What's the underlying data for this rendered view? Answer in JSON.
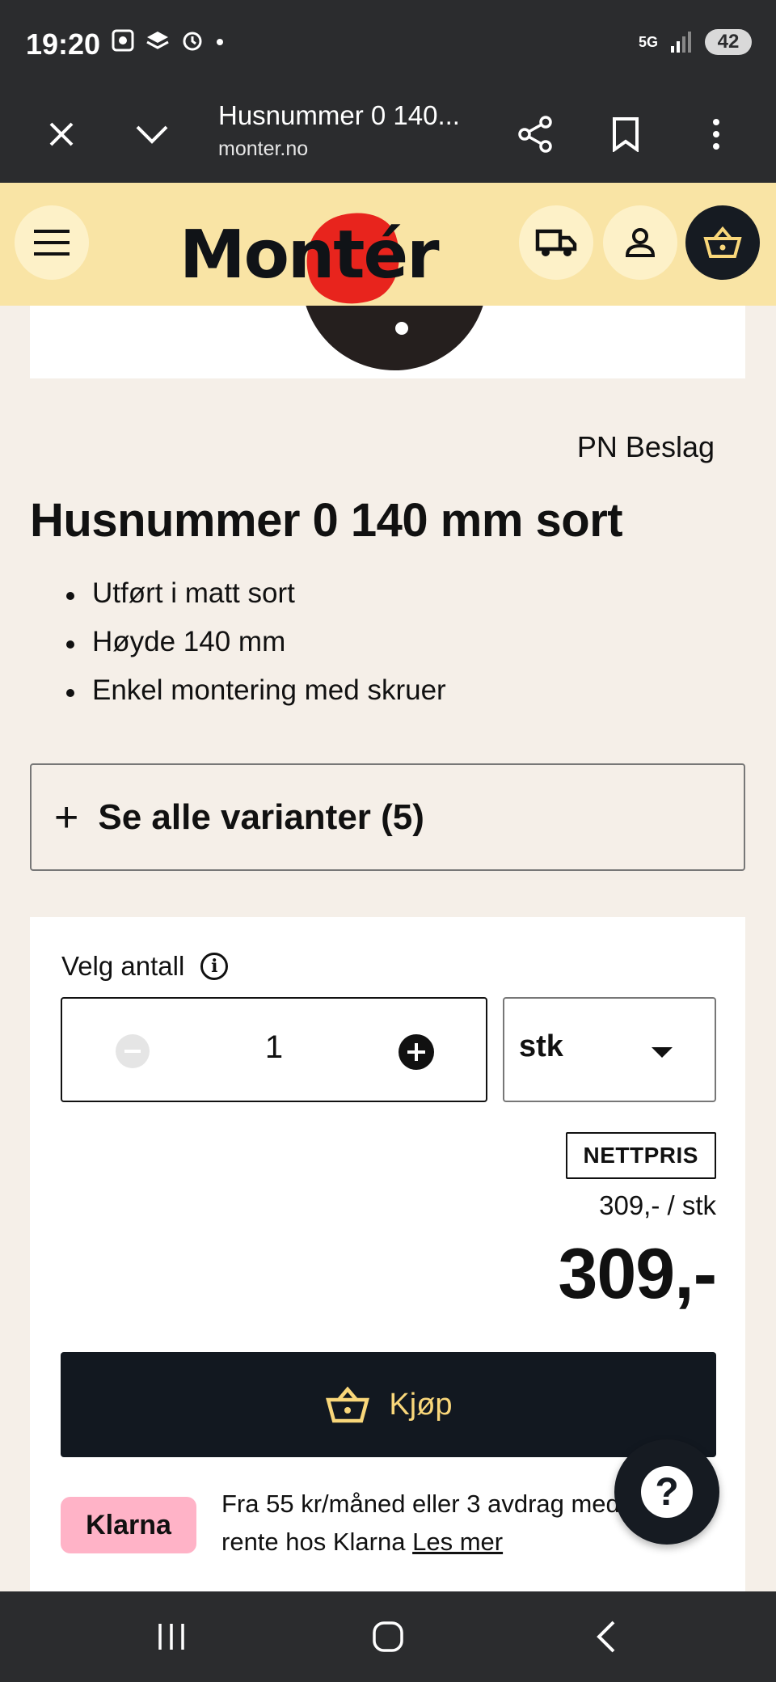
{
  "status_bar": {
    "time": "19:20",
    "network": "5G",
    "battery": "42",
    "icons": [
      "screenshot-icon",
      "stack-icon",
      "alarm-icon",
      "dot-icon",
      "signal-icon"
    ]
  },
  "browser": {
    "title": "Husnummer 0 140...",
    "url": "monter.no",
    "icons": [
      "close-icon",
      "chevron-down-icon",
      "share-icon",
      "bookmark-icon",
      "more-icon"
    ]
  },
  "site_header": {
    "logo_text": "Montér",
    "icons": [
      "menu-icon",
      "truck-icon",
      "user-icon",
      "basket-icon"
    ],
    "colors": {
      "header_bg": "#f9e4a5",
      "logo_accent": "#e8241d"
    }
  },
  "product": {
    "brand": "PN Beslag",
    "title": "Husnummer 0 140 mm sort",
    "bullets": [
      "Utført i matt sort",
      "Høyde 140 mm",
      "Enkel montering med skruer"
    ],
    "variants_label": "Se alle varianter (5)"
  },
  "purchase": {
    "quantity_label": "Velg antall",
    "quantity": "1",
    "unit": "stk",
    "badge": "NETTPRIS",
    "unit_price": "309,- / stk",
    "price": "309,-",
    "buy_label": "Kjøp",
    "klarna_logo": "Klarna",
    "klarna_text": "Fra 55 kr/måned eller 3 avdrag med rente hos Klarna",
    "klarna_link": "Les mer",
    "colors": {
      "buy_bg": "#121820",
      "buy_text": "#f9d77a",
      "klarna_bg": "#ffb3c7"
    }
  },
  "help": {
    "symbol": "?"
  }
}
